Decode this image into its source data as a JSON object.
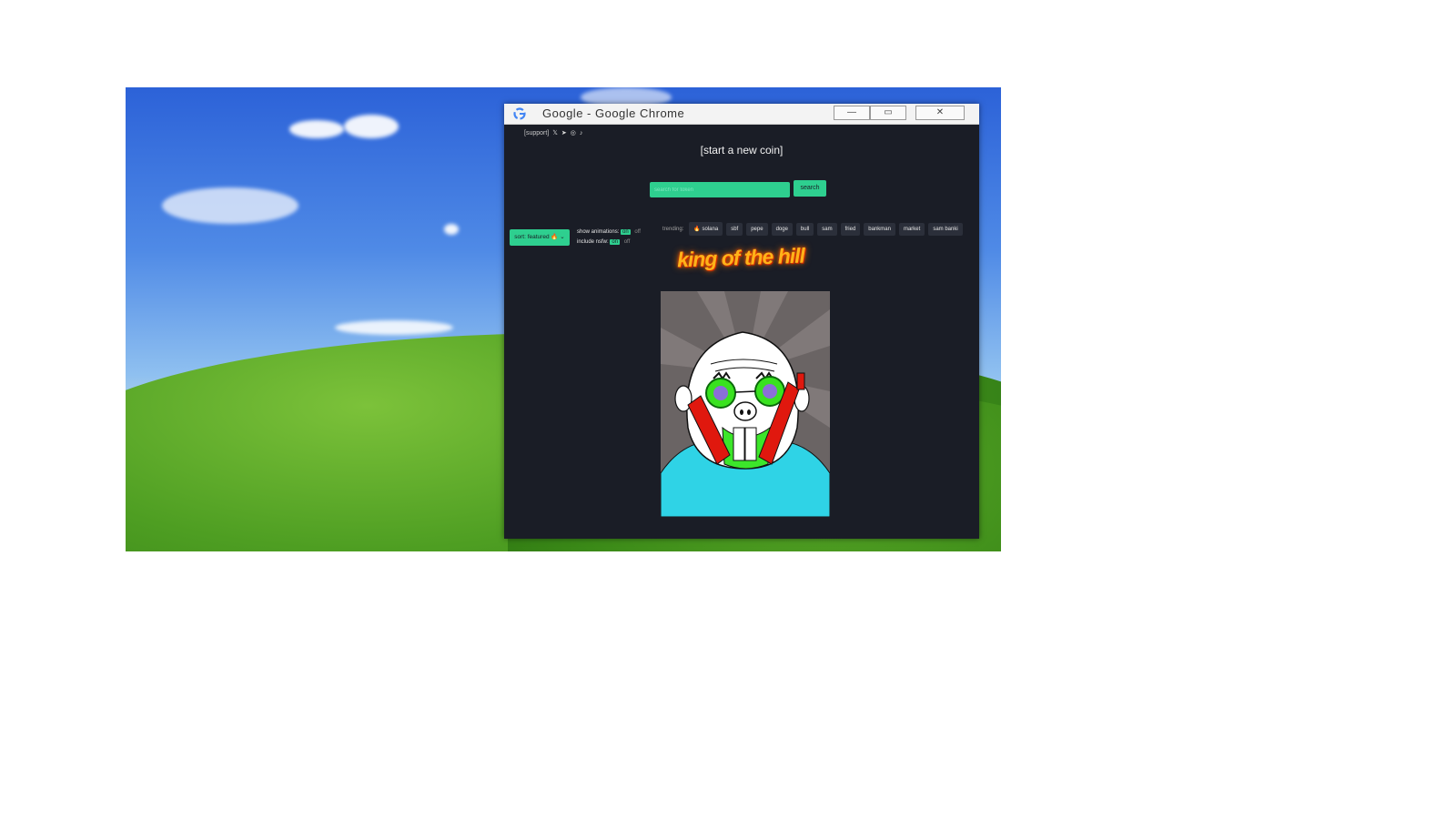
{
  "window": {
    "title": "Google - Google Chrome",
    "minimize_label": "—",
    "restore_label": "▭",
    "close_label": "✕"
  },
  "header": {
    "support_link": "[support]",
    "social_icons": [
      "x-icon",
      "telegram-icon",
      "instagram-icon",
      "tiktok-icon"
    ],
    "new_coin_link": "[start a new coin]"
  },
  "search": {
    "placeholder": "search for token",
    "button_label": "search"
  },
  "controls": {
    "sort_label": "sort: featured 🔥 ⌄",
    "show_animations_label": "show animations:",
    "include_nsfw_label": "include nsfw:",
    "on_label": "on",
    "off_label": "off"
  },
  "trending": {
    "label": "trending:",
    "items": [
      "🔥 solana",
      "sbf",
      "pepe",
      "doge",
      "bull",
      "sam",
      "fried",
      "bankman",
      "market",
      "sam banki"
    ]
  },
  "king_of_the_hill": {
    "title": "king of the hill",
    "image_icon": "cartoon-character-image"
  },
  "colors": {
    "accent": "#2ecf8f",
    "background": "#1a1d26",
    "chip": "#2b2f3a",
    "king_title": "#ffb319"
  }
}
